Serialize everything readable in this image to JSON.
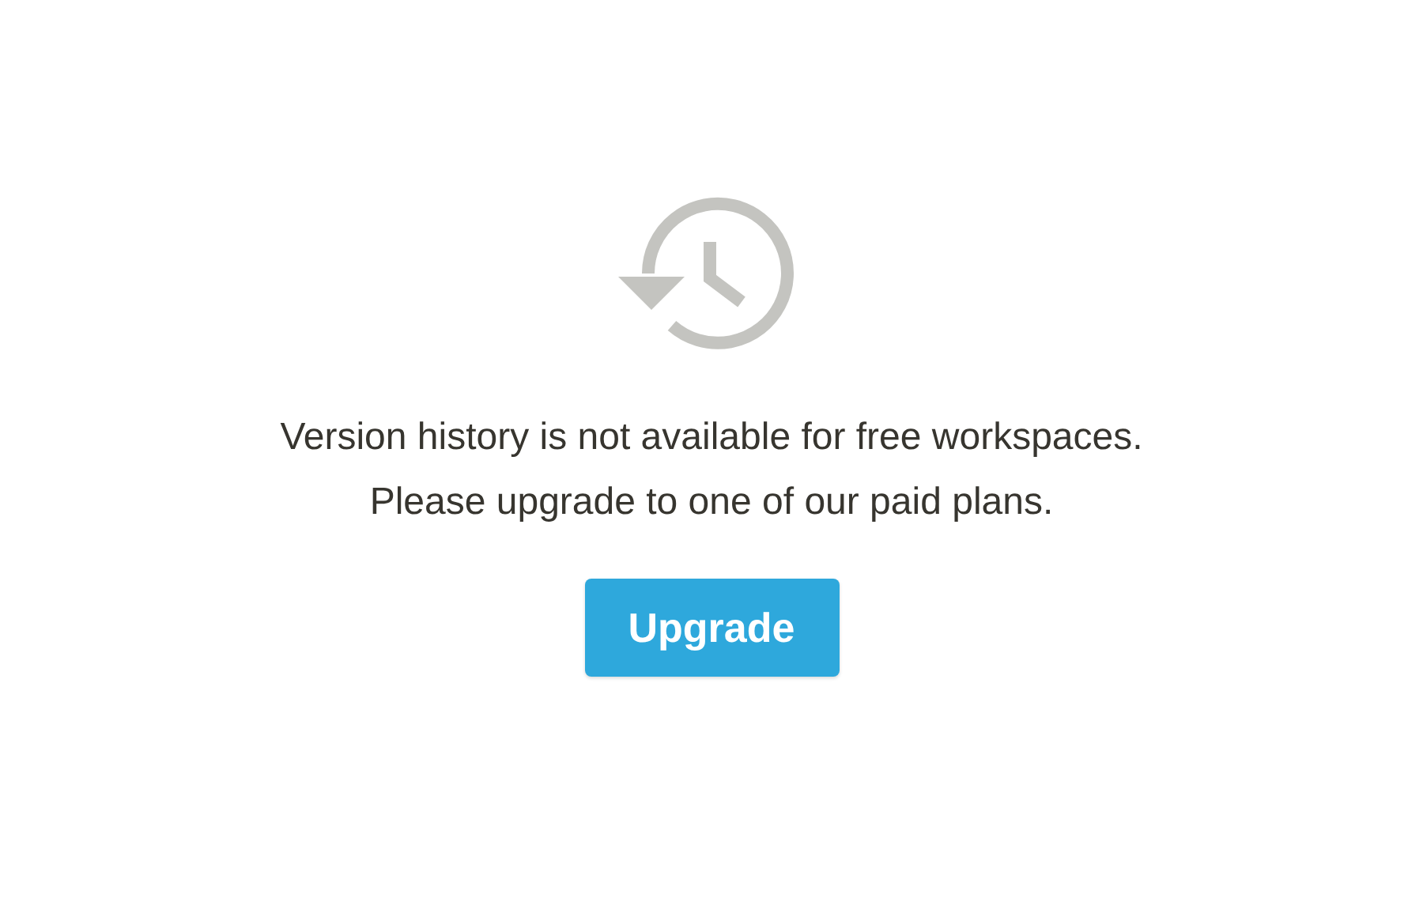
{
  "message": [
    "Version history is not available for free workspaces.",
    "Please upgrade to one of our paid plans."
  ],
  "button": {
    "label": "Upgrade"
  }
}
